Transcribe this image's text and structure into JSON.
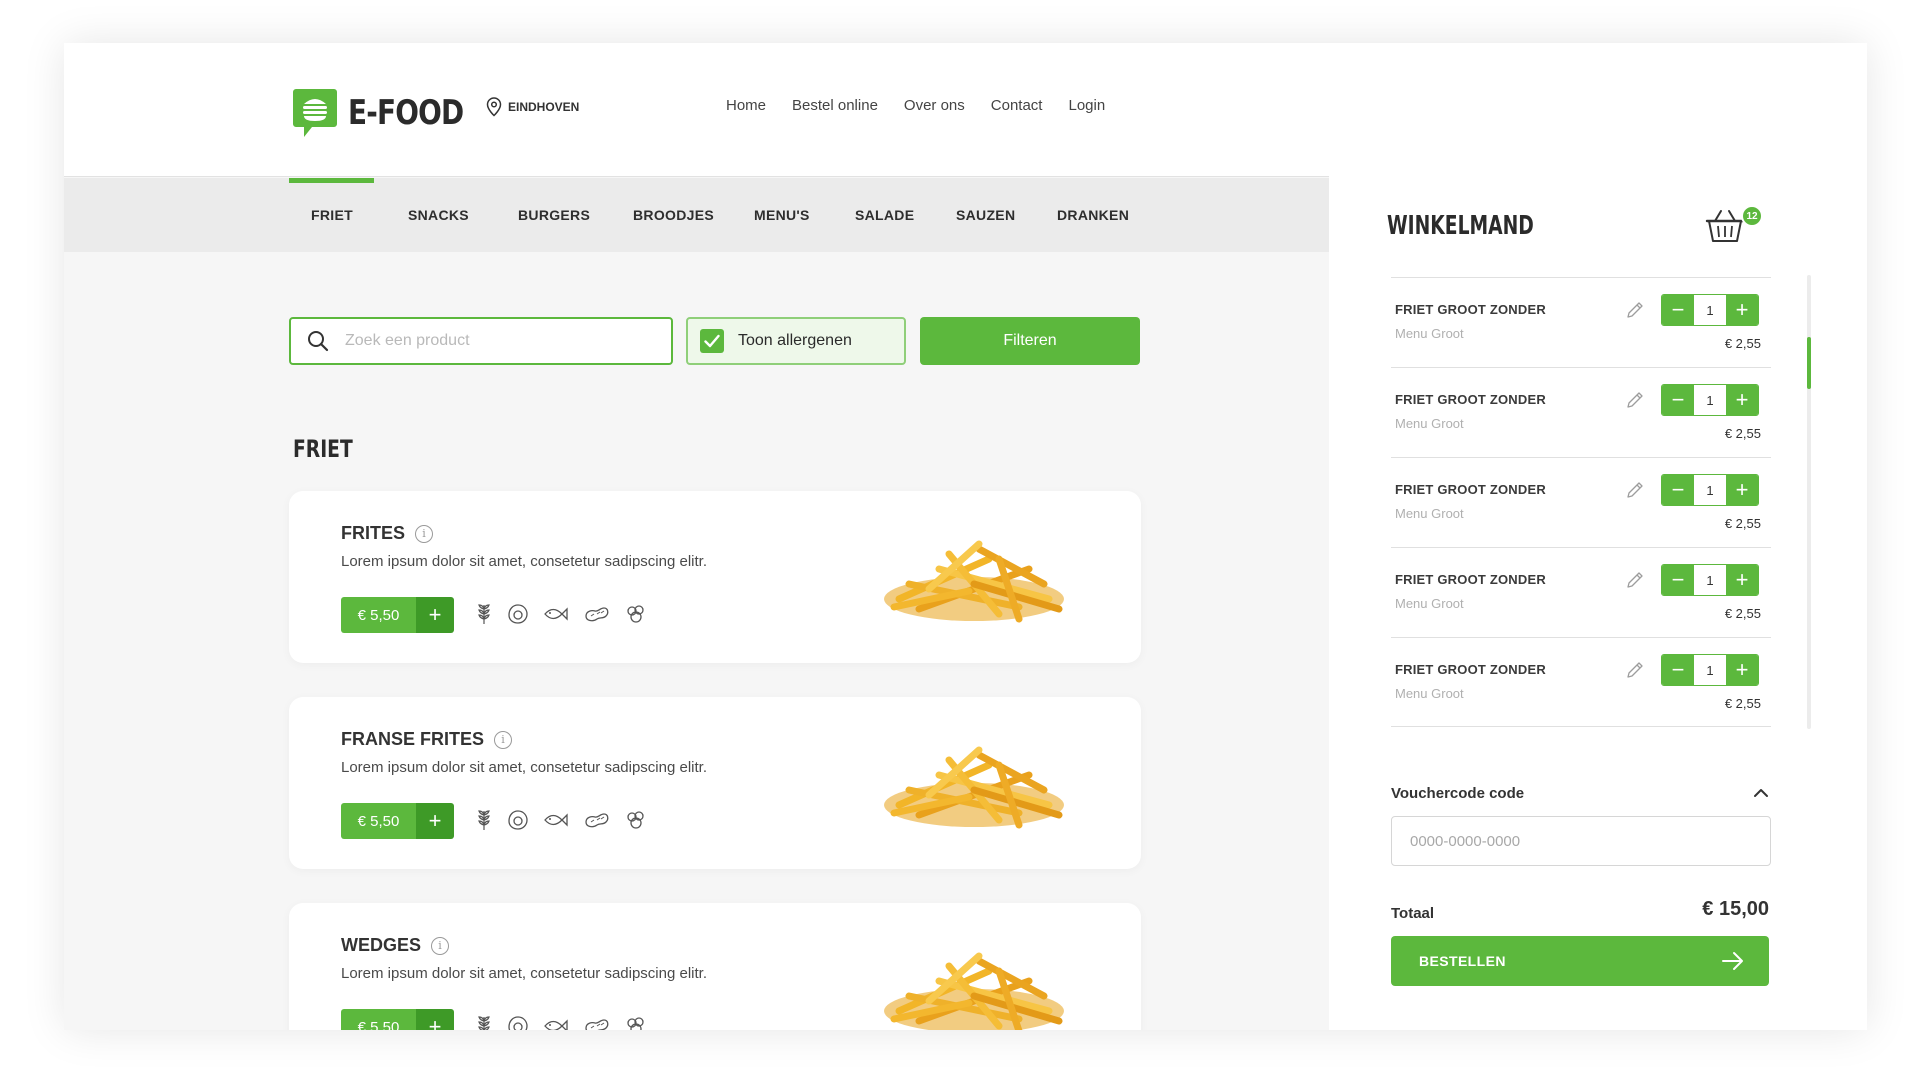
{
  "brand": {
    "name": "E-FOOD",
    "location": "EINDHOVEN",
    "accent": "#5cb83d",
    "accent_dark": "#3e9a27"
  },
  "topnav": [
    "Home",
    "Bestel online",
    "Over ons",
    "Contact",
    "Login"
  ],
  "categories": [
    "FRIET",
    "SNACKS",
    "BURGERS",
    "BROODJES",
    "MENU'S",
    "SALADE",
    "SAUZEN",
    "DRANKEN"
  ],
  "active_category": "FRIET",
  "search": {
    "placeholder": "Zoek een product",
    "value": ""
  },
  "allergen_toggle": {
    "label": "Toon allergenen",
    "checked": true
  },
  "filter_button": "Filteren",
  "section_title": "FRIET",
  "products": [
    {
      "name": "FRITES",
      "description": "Lorem ipsum dolor sit amet, consetetur sadipscing elitr.",
      "price": "€ 5,50",
      "allergen_icons": [
        "wheat-icon",
        "egg-icon",
        "fish-icon",
        "peanut-icon",
        "soy-icon"
      ]
    },
    {
      "name": "FRANSE FRITES",
      "description": "Lorem ipsum dolor sit amet, consetetur sadipscing elitr.",
      "price": "€ 5,50",
      "allergen_icons": [
        "wheat-icon",
        "egg-icon",
        "fish-icon",
        "peanut-icon",
        "soy-icon"
      ]
    },
    {
      "name": "WEDGES",
      "description": "Lorem ipsum dolor sit amet, consetetur sadipscing elitr.",
      "price": "€ 5,50",
      "allergen_icons": [
        "wheat-icon",
        "egg-icon",
        "fish-icon",
        "peanut-icon",
        "soy-icon"
      ]
    }
  ],
  "cart": {
    "title": "WINKELMAND",
    "count": "12",
    "items": [
      {
        "name": "FRIET GROOT ZONDER",
        "sub": "Menu Groot",
        "qty": "1",
        "price": "€ 2,55"
      },
      {
        "name": "FRIET GROOT ZONDER",
        "sub": "Menu Groot",
        "qty": "1",
        "price": "€ 2,55"
      },
      {
        "name": "FRIET GROOT ZONDER",
        "sub": "Menu Groot",
        "qty": "1",
        "price": "€ 2,55"
      },
      {
        "name": "FRIET GROOT ZONDER",
        "sub": "Menu Groot",
        "qty": "1",
        "price": "€ 2,55"
      },
      {
        "name": "FRIET GROOT ZONDER",
        "sub": "Menu Groot",
        "qty": "1",
        "price": "€ 2,55"
      }
    ],
    "voucher": {
      "label": "Vouchercode code",
      "placeholder": "0000-0000-0000",
      "value": ""
    },
    "total_label": "Totaal",
    "total_value": "€ 15,00",
    "order_button": "BESTELLEN"
  }
}
